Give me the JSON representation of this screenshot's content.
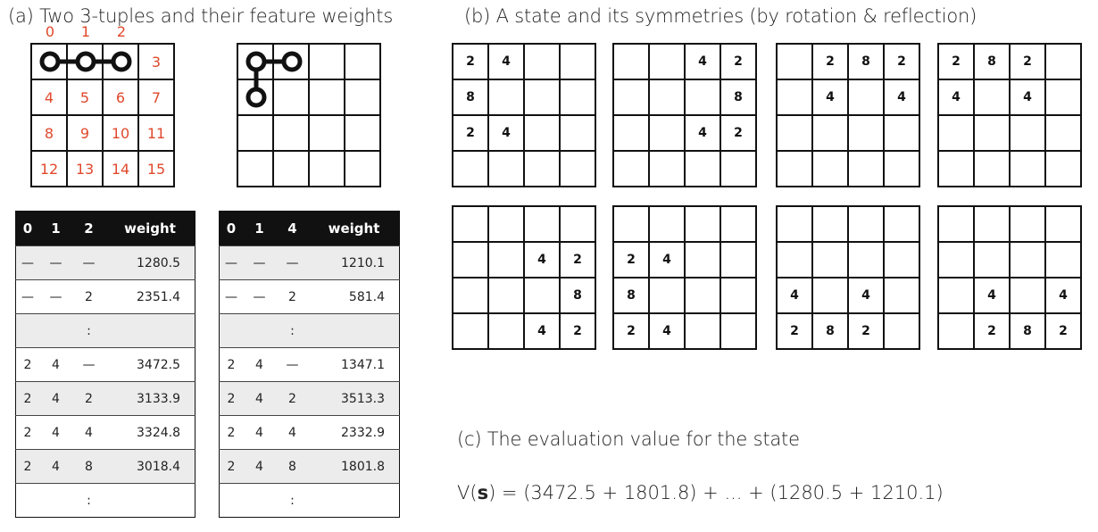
{
  "titles": {
    "a": "(a) Two 3-tuples and their feature weights",
    "b": "(b) A state and its symmetries (by rotation & reflection)",
    "c": "(c) The evaluation value for the state"
  },
  "index_board": {
    "top_labels": [
      "0",
      "1",
      "2"
    ],
    "cells": [
      "",
      "",
      "",
      "3",
      "4",
      "5",
      "6",
      "7",
      "8",
      "9",
      "10",
      "11",
      "12",
      "13",
      "14",
      "15"
    ]
  },
  "colors": {
    "index": "#e0492c",
    "header_bg": "#111111",
    "row_shade": "#ececec"
  },
  "table1": {
    "headers": [
      "0",
      "1",
      "2",
      "weight"
    ],
    "rows": [
      [
        "—",
        "—",
        "—",
        "1280.5"
      ],
      [
        "—",
        "—",
        "2",
        "2351.4"
      ],
      [
        "",
        "",
        ":",
        ""
      ],
      [
        "2",
        "4",
        "—",
        "3472.5"
      ],
      [
        "2",
        "4",
        "2",
        "3133.9"
      ],
      [
        "2",
        "4",
        "4",
        "3324.8"
      ],
      [
        "2",
        "4",
        "8",
        "3018.4"
      ],
      [
        "",
        "",
        ":",
        ""
      ]
    ]
  },
  "table2": {
    "headers": [
      "0",
      "1",
      "4",
      "weight"
    ],
    "rows": [
      [
        "—",
        "—",
        "—",
        "1210.1"
      ],
      [
        "—",
        "—",
        "2",
        "581.4"
      ],
      [
        "",
        "",
        ":",
        ""
      ],
      [
        "2",
        "4",
        "—",
        "1347.1"
      ],
      [
        "2",
        "4",
        "2",
        "3513.3"
      ],
      [
        "2",
        "4",
        "4",
        "2332.9"
      ],
      [
        "2",
        "4",
        "8",
        "1801.8"
      ],
      [
        "",
        "",
        ":",
        ""
      ]
    ]
  },
  "boards": [
    [
      "2",
      "4",
      "",
      "",
      "8",
      "",
      "",
      "",
      "2",
      "4",
      "",
      "",
      "",
      "",
      "",
      ""
    ],
    [
      "",
      "",
      "4",
      "2",
      "",
      "",
      "",
      "8",
      "",
      "",
      "4",
      "2",
      "",
      "",
      "",
      ""
    ],
    [
      "",
      "2",
      "8",
      "2",
      "",
      "4",
      "",
      "4",
      "",
      "",
      "",
      "",
      "",
      "",
      "",
      ""
    ],
    [
      "2",
      "8",
      "2",
      "",
      "4",
      "",
      "4",
      "",
      "",
      "",
      "",
      "",
      "",
      "",
      "",
      ""
    ],
    [
      "",
      "",
      "",
      "",
      "",
      "",
      "4",
      "2",
      "",
      "",
      "",
      "8",
      "",
      "",
      "4",
      "2"
    ],
    [
      "",
      "",
      "",
      "",
      "2",
      "4",
      "",
      "",
      "8",
      "",
      "",
      "",
      "2",
      "4",
      "",
      ""
    ],
    [
      "",
      "",
      "",
      "",
      "",
      "",
      "",
      "",
      "4",
      "",
      "4",
      "",
      "2",
      "8",
      "2",
      ""
    ],
    [
      "",
      "",
      "",
      "",
      "",
      "",
      "",
      "",
      "",
      "4",
      "",
      "4",
      "",
      "2",
      "8",
      "2"
    ]
  ],
  "equation": {
    "lhs": "V(",
    "state": "s",
    "rhs": ") = (3472.5 + 1801.8) + ... + (1280.5 + 1210.1)"
  }
}
